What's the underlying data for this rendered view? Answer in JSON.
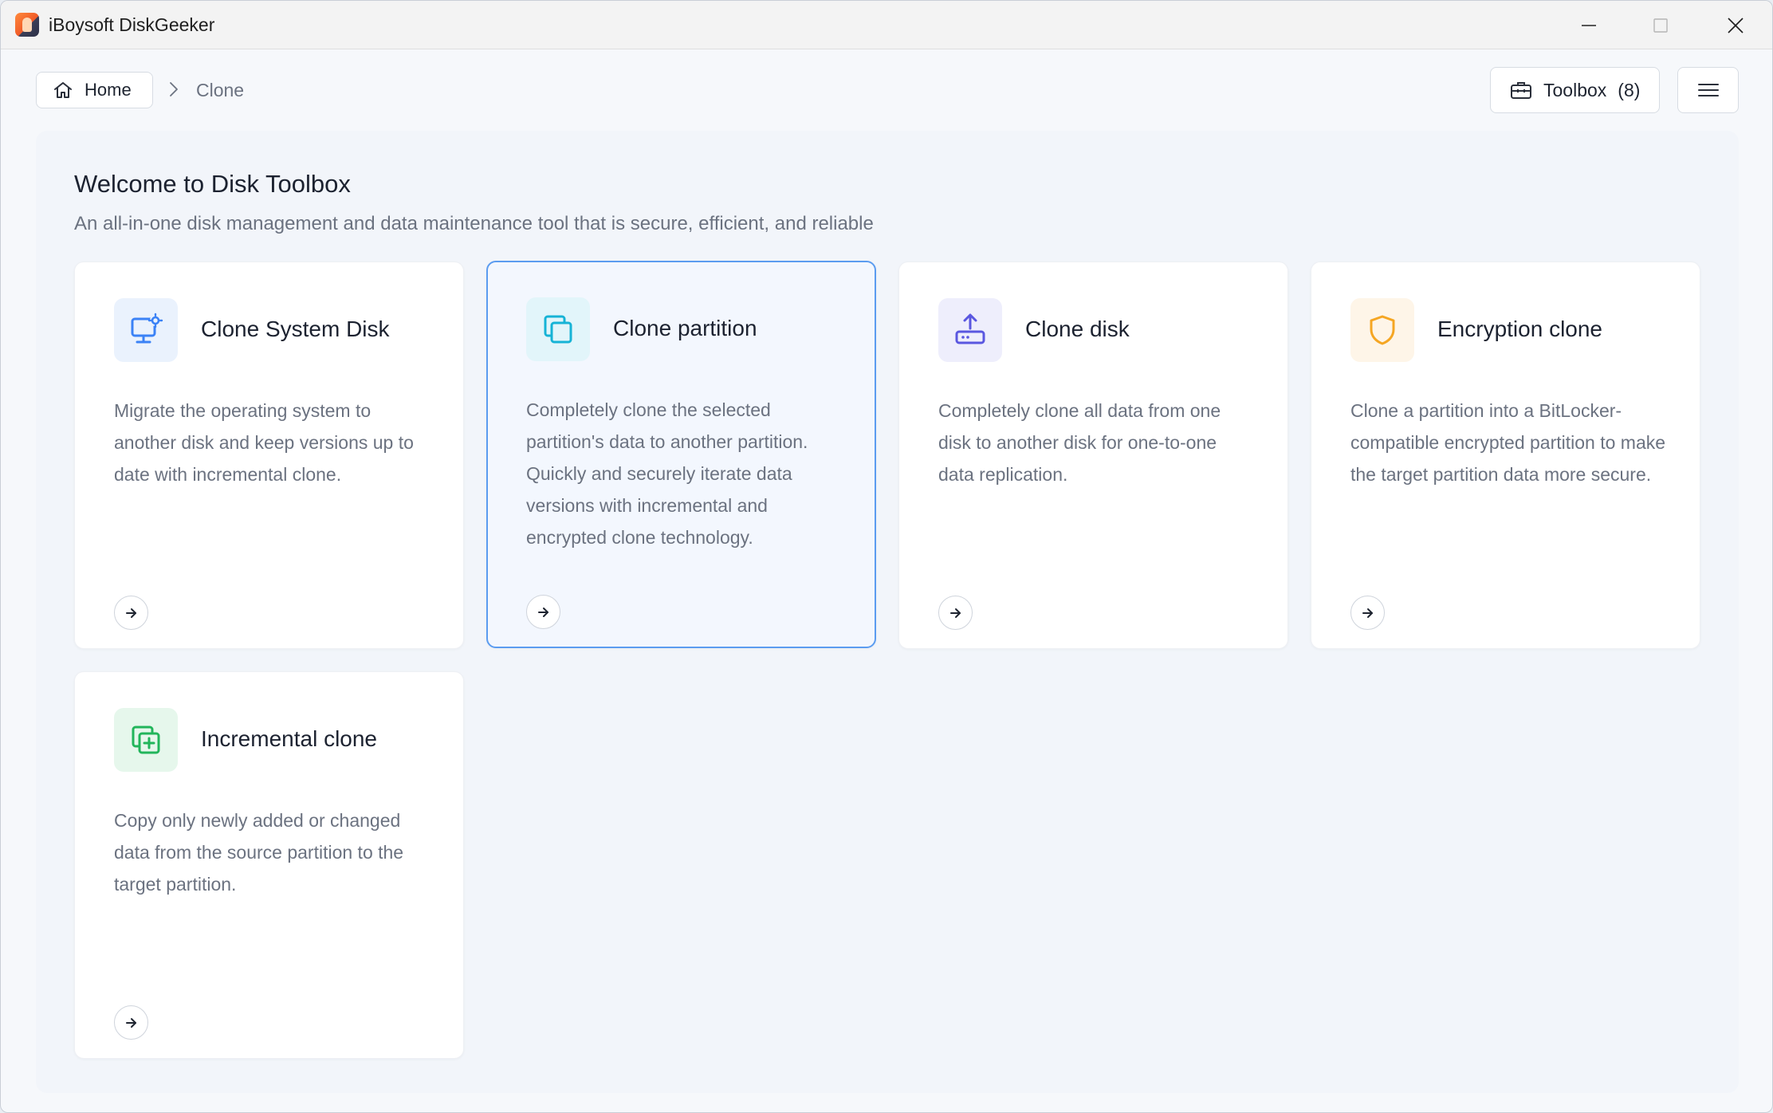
{
  "window": {
    "app_title": "iBoysoft DiskGeeker"
  },
  "header": {
    "home_label": "Home",
    "breadcrumb_current": "Clone",
    "toolbox_label": "Toolbox",
    "toolbox_count": "(8)"
  },
  "main": {
    "title": "Welcome to Disk Toolbox",
    "subtitle": "An all-in-one disk management and data maintenance tool that is secure, efficient, and reliable",
    "cards": [
      {
        "title": "Clone System Disk",
        "description": "Migrate the operating system to another disk and keep versions up to date with incremental clone.",
        "icon": "monitor-gear-icon",
        "accent": "#3b82f6",
        "icon_bg": "#eaf2fd",
        "selected": false
      },
      {
        "title": "Clone partition",
        "description": "Completely clone the selected partition's data to another partition. Quickly and securely iterate data versions with incremental and encrypted clone technology.",
        "icon": "copy-icon",
        "accent": "#16b3d6",
        "icon_bg": "#e2f5fa",
        "selected": true
      },
      {
        "title": "Clone disk",
        "description": "Completely clone all data from one disk to another disk for one-to-one data replication.",
        "icon": "disk-upload-icon",
        "accent": "#5a57e0",
        "icon_bg": "#eeeefc",
        "selected": false
      },
      {
        "title": "Encryption clone",
        "description": "Clone a partition into a BitLocker-compatible encrypted partition to make the target partition data more secure.",
        "icon": "shield-icon",
        "accent": "#f5a623",
        "icon_bg": "#fef5e8",
        "selected": false
      },
      {
        "title": "Incremental clone",
        "description": "Copy only newly added or changed data from the source partition to the target partition.",
        "icon": "copy-plus-icon",
        "accent": "#22b55b",
        "icon_bg": "#e6f7ec",
        "selected": false
      }
    ]
  }
}
